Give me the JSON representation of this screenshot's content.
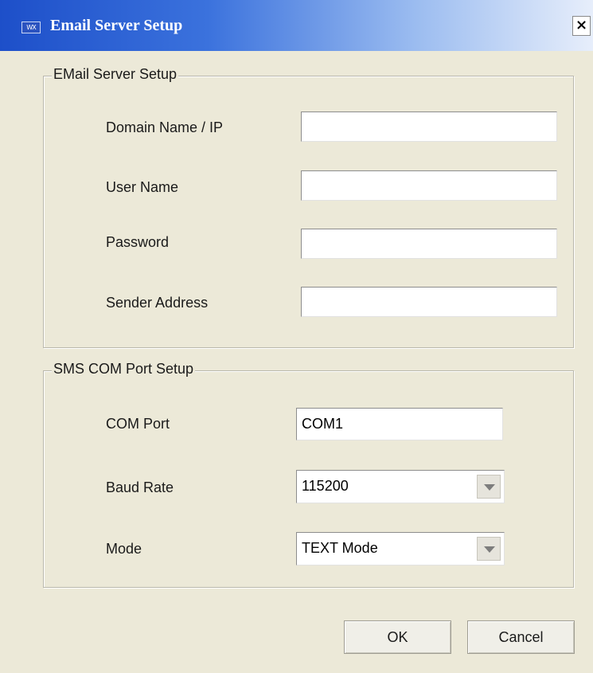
{
  "window": {
    "title": "Email Server Setup",
    "icon": "app-icon",
    "icon_text": "WX",
    "close_symbol": "×"
  },
  "email_group": {
    "legend": "EMail Server Setup",
    "fields": [
      {
        "label": "Domain Name / IP",
        "value": ""
      },
      {
        "label": "User Name",
        "value": ""
      },
      {
        "label": "Password",
        "value": ""
      },
      {
        "label": "Sender Address",
        "value": ""
      }
    ]
  },
  "sms_group": {
    "legend": "SMS COM Port Setup",
    "com_port": {
      "label": "COM Port",
      "value": "COM1"
    },
    "baud_rate": {
      "label": "Baud Rate",
      "value": "115200"
    },
    "mode": {
      "label": "Mode",
      "value": "TEXT Mode"
    }
  },
  "buttons": {
    "ok": "OK",
    "cancel": "Cancel"
  },
  "colors": {
    "title_bar": "#1d4fc9",
    "dialog_bg": "#ece9d8"
  }
}
